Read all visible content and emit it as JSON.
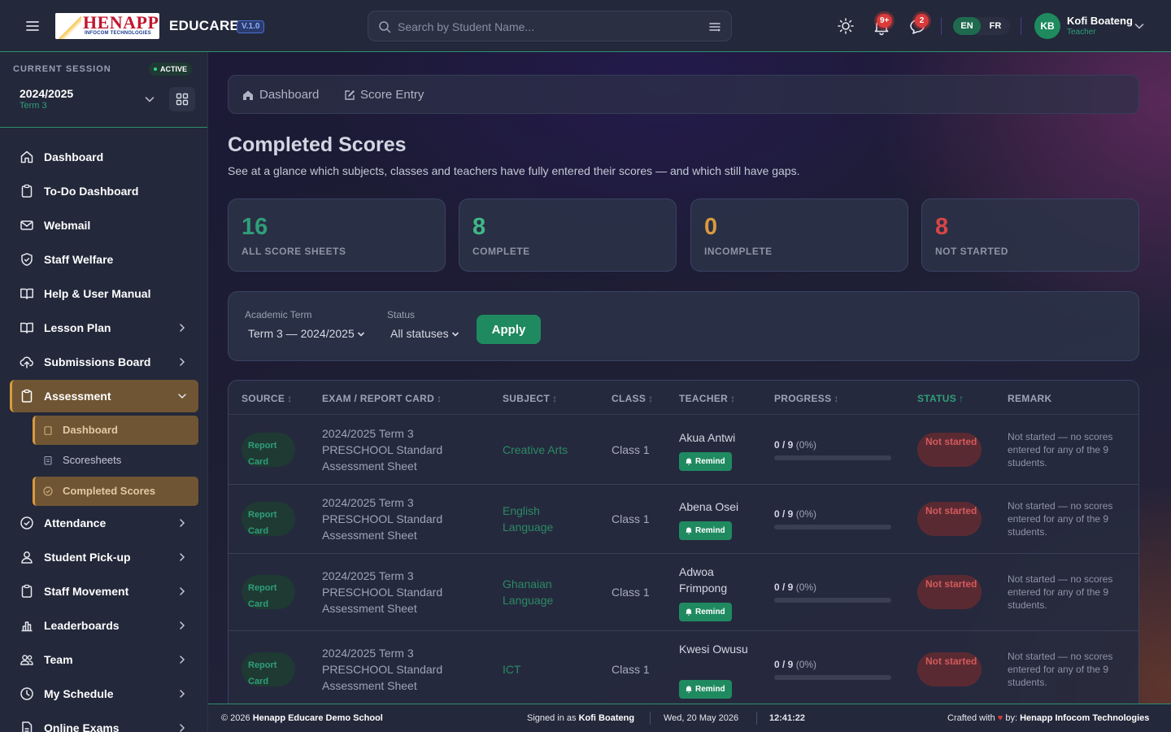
{
  "app": {
    "logo_text": "HENAPP",
    "logo_subtext": "INFOCOM TECHNOLOGIES",
    "brand": "EDUCARE",
    "version": "V.1.0"
  },
  "search": {
    "placeholder": "Search by Student Name..."
  },
  "notifications": {
    "alerts_count": "9+",
    "messages_count": "2"
  },
  "language": {
    "options": [
      "EN",
      "FR"
    ],
    "selected": "EN"
  },
  "user": {
    "initials": "KB",
    "name": "Kofi Boateng",
    "role": "Teacher"
  },
  "session": {
    "label": "CURRENT SESSION",
    "status": "ACTIVE",
    "year": "2024/2025",
    "term": "Term 3"
  },
  "sidebar": {
    "items": [
      {
        "label": "Dashboard",
        "icon": "home-icon"
      },
      {
        "label": "To-Do Dashboard",
        "icon": "clipboard-icon"
      },
      {
        "label": "Webmail",
        "icon": "mail-icon"
      },
      {
        "label": "Staff Welfare",
        "icon": "shield-icon"
      },
      {
        "label": "Help & User Manual",
        "icon": "book-icon"
      },
      {
        "label": "Lesson Plan",
        "icon": "book-open-icon"
      },
      {
        "label": "Submissions Board",
        "icon": "cloud-upload-icon"
      },
      {
        "label": "Assessment",
        "icon": "clipboard-icon",
        "expanded": true
      },
      {
        "label": "Attendance",
        "icon": "check-circle-icon"
      },
      {
        "label": "Student Pick-up",
        "icon": "user-icon"
      },
      {
        "label": "Staff Movement",
        "icon": "clipboard-icon"
      },
      {
        "label": "Leaderboards",
        "icon": "bar-chart-icon"
      },
      {
        "label": "Team",
        "icon": "users-icon"
      },
      {
        "label": "My Schedule",
        "icon": "clock-icon"
      },
      {
        "label": "Online Exams",
        "icon": "file-icon"
      }
    ],
    "assessment_sub": [
      {
        "label": "Dashboard"
      },
      {
        "label": "Scoresheets"
      },
      {
        "label": "Completed Scores",
        "active": true
      }
    ]
  },
  "breadcrumb": [
    {
      "label": "Dashboard",
      "icon": "home-icon"
    },
    {
      "label": "Score Entry",
      "icon": "edit-icon"
    }
  ],
  "page": {
    "title": "Completed Scores",
    "subtitle": "See at a glance which subjects, classes and teachers have fully entered their scores — and which still have gaps."
  },
  "stats": [
    {
      "value": "16",
      "label": "ALL SCORE SHEETS",
      "color": "#2f9f78"
    },
    {
      "value": "8",
      "label": "COMPLETE",
      "color": "#3fb886"
    },
    {
      "value": "0",
      "label": "INCOMPLETE",
      "color": "#d99a3e"
    },
    {
      "value": "8",
      "label": "NOT STARTED",
      "color": "#d94545"
    }
  ],
  "filters": {
    "term_label": "Academic Term",
    "term_value": "Term 3 — 2024/2025",
    "status_label": "Status",
    "status_value": "All statuses",
    "apply_label": "Apply"
  },
  "table": {
    "columns": [
      "SOURCE",
      "EXAM / REPORT CARD",
      "SUBJECT",
      "CLASS",
      "TEACHER",
      "PROGRESS",
      "STATUS",
      "REMARK"
    ],
    "sort_marks": {
      "neutral": "↕",
      "asc": "↑"
    },
    "remind_label": "Remind",
    "rows": [
      {
        "source": "Report Card",
        "exam": "2024/2025 Term 3 PRESCHOOL Standard Assessment Sheet",
        "subject": "Creative Arts",
        "class": "Class 1",
        "teacher": "Akua Antwi",
        "progress_count": "0 / 9",
        "progress_pct": "(0%)",
        "progress_fraction": 0,
        "status": "Not started",
        "remark": "Not started — no scores entered for any of the 9 students."
      },
      {
        "source": "Report Card",
        "exam": "2024/2025 Term 3 PRESCHOOL Standard Assessment Sheet",
        "subject": "English Language",
        "class": "Class 1",
        "teacher": "Abena Osei",
        "progress_count": "0 / 9",
        "progress_pct": "(0%)",
        "progress_fraction": 0,
        "status": "Not started",
        "remark": "Not started — no scores entered for any of the 9 students."
      },
      {
        "source": "Report Card",
        "exam": "2024/2025 Term 3 PRESCHOOL Standard Assessment Sheet",
        "subject": "Ghanaian Language",
        "class": "Class 1",
        "teacher": "Adwoa Frimpong",
        "progress_count": "0 / 9",
        "progress_pct": "(0%)",
        "progress_fraction": 0,
        "status": "Not started",
        "remark": "Not started — no scores entered for any of the 9 students."
      },
      {
        "source": "Report Card",
        "exam": "2024/2025 Term 3 PRESCHOOL Standard Assessment Sheet",
        "subject": "ICT",
        "class": "Class 1",
        "teacher": "Kwesi Owusu",
        "progress_count": "0 / 9",
        "progress_pct": "(0%)",
        "progress_fraction": 0,
        "status": "Not started",
        "remark": "Not started — no scores entered for any of the 9 students."
      }
    ]
  },
  "footer": {
    "copyright_prefix": "© 2026",
    "school": "Henapp Educare Demo School",
    "signed_in_prefix": "Signed in as",
    "signed_in_user": "Kofi Boateng",
    "date": "Wed, 20 May 2026",
    "time": "12:41:22",
    "crafted_prefix": "Crafted with",
    "crafted_by": "by:",
    "company": "Henapp Infocom Technologies"
  }
}
